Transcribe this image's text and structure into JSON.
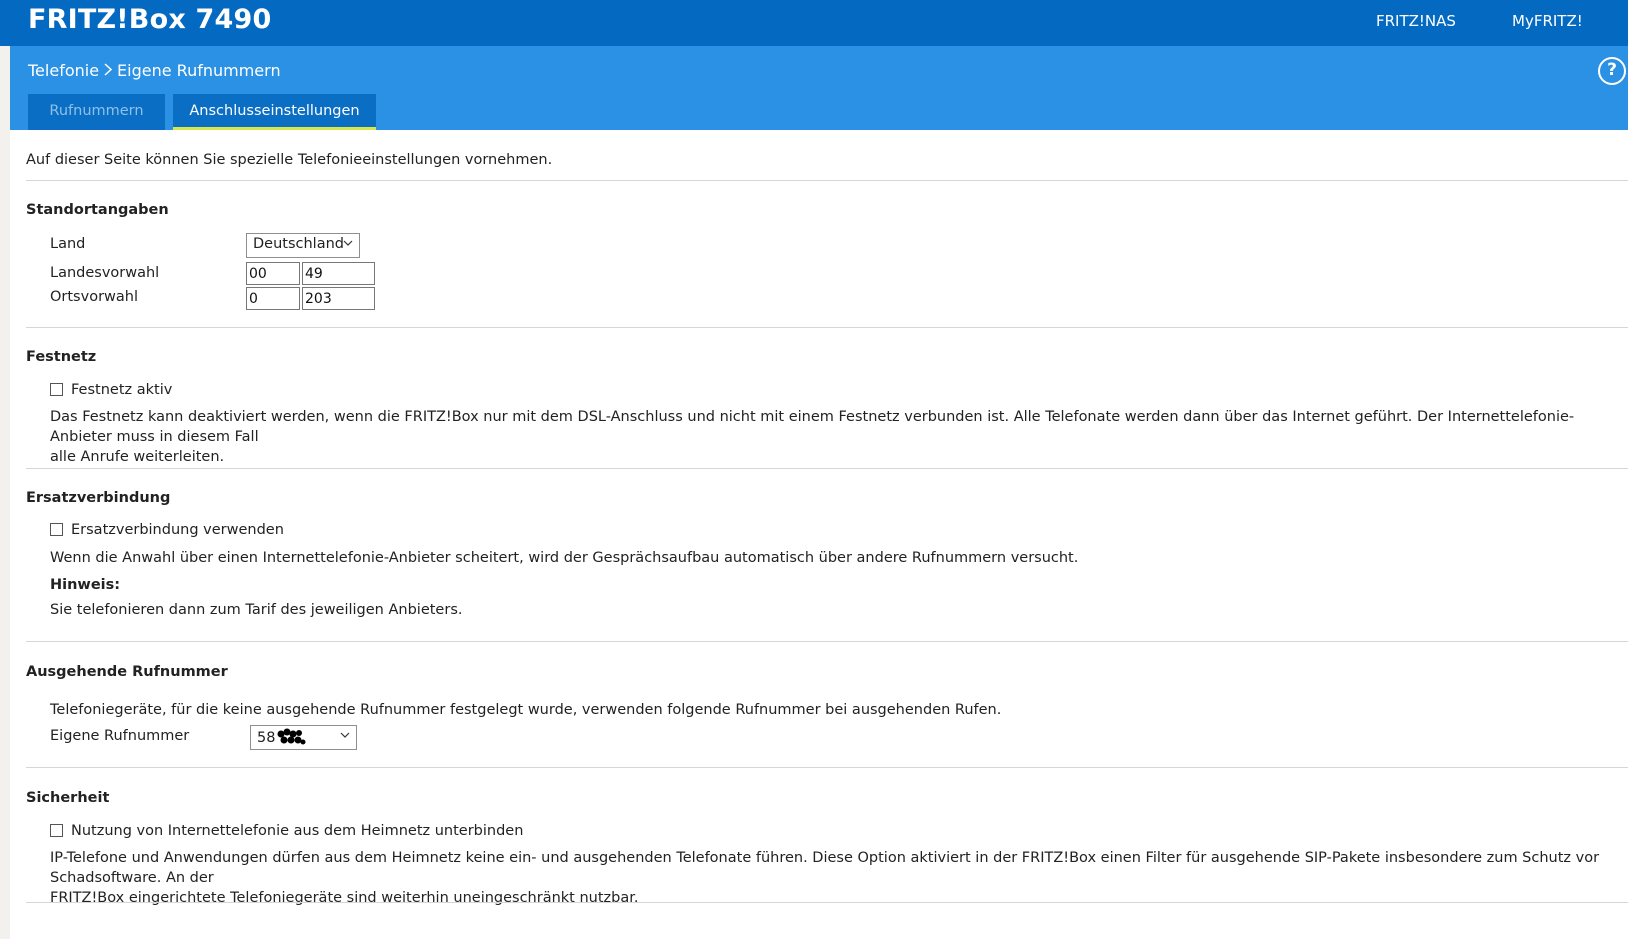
{
  "header": {
    "brand": "FRITZ!Box 7490",
    "links": [
      "FRITZ!NAS",
      "MyFRITZ!"
    ]
  },
  "subheader": {
    "breadcrumb": [
      "Telefonie",
      "Eigene Rufnummern"
    ],
    "help_glyph": "?",
    "tabs": [
      {
        "label": "Rufnummern",
        "active": false
      },
      {
        "label": "Anschlusseinstellungen",
        "active": true
      }
    ]
  },
  "intro": "Auf dieser Seite können Sie spezielle Telefonieeinstellungen vornehmen.",
  "standort": {
    "title": "Standortangaben",
    "land_label": "Land",
    "land_value": "Deutschland",
    "landesvorwahl_label": "Landesvorwahl",
    "landesvorwahl_prefix": "00",
    "landesvorwahl_value": "49",
    "ortsvorwahl_label": "Ortsvorwahl",
    "ortsvorwahl_prefix": "0",
    "ortsvorwahl_value": "203"
  },
  "festnetz": {
    "title": "Festnetz",
    "checkbox_label": "Festnetz aktiv",
    "checked": false,
    "desc_line1": "Das Festnetz kann deaktiviert werden, wenn die FRITZ!Box nur mit dem DSL-Anschluss und nicht mit einem Festnetz verbunden ist. Alle Telefonate werden dann über das Internet geführt. Der Internettelefonie-Anbieter muss in diesem Fall",
    "desc_line2": "alle Anrufe weiterleiten."
  },
  "ersatz": {
    "title": "Ersatzverbindung",
    "checkbox_label": "Ersatzverbindung verwenden",
    "checked": false,
    "desc": "Wenn die Anwahl über einen Internettelefonie-Anbieter scheitert, wird der Gesprächsaufbau automatisch über andere Rufnummern versucht.",
    "hint_title": "Hinweis:",
    "hint_text": "Sie telefonieren dann zum Tarif des jeweiligen Anbieters."
  },
  "ausgehend": {
    "title": "Ausgehende Rufnummer",
    "desc": "Telefoniegeräte, für die keine ausgehende Rufnummer festgelegt wurde, verwenden folgende Rufnummer bei ausgehenden Rufen.",
    "label": "Eigene Rufnummer",
    "value_visible": "58"
  },
  "sicherheit": {
    "title": "Sicherheit",
    "checkbox_label": "Nutzung von Internettelefonie aus dem Heimnetz unterbinden",
    "checked": false,
    "desc_line1": "IP-Telefone und Anwendungen dürfen aus dem Heimnetz keine ein- und ausgehenden Telefonate führen. Diese Option aktiviert in der FRITZ!Box einen Filter für ausgehende SIP-Pakete insbesondere zum Schutz vor Schadsoftware. An der",
    "desc_line2": "FRITZ!Box eingerichtete Telefoniegeräte sind weiterhin uneingeschränkt nutzbar."
  },
  "colors": {
    "topbar": "#0369c1",
    "subbar": "#2a91e5",
    "tab_bg": "#0a6ec4",
    "tab_active_underline": "#d8e64a"
  }
}
